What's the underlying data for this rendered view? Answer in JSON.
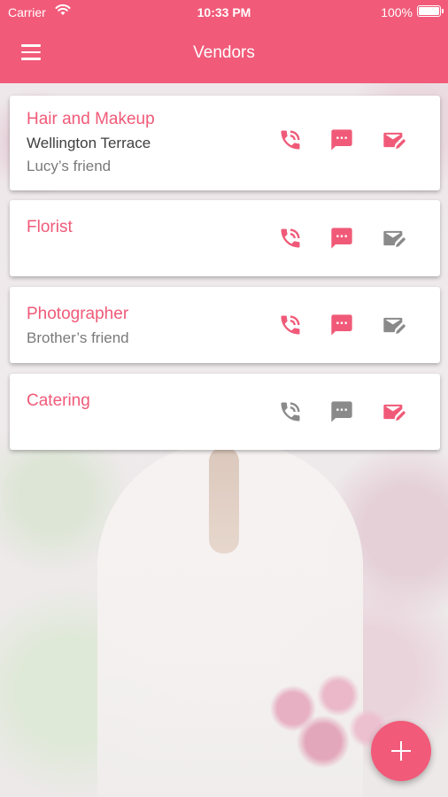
{
  "status_bar": {
    "carrier": "Carrier",
    "time": "10:33 PM",
    "battery": "100%"
  },
  "header": {
    "title": "Vendors"
  },
  "colors": {
    "accent": "#f25a79",
    "active_icon": "#f05a78",
    "inactive_icon": "#8a8a8a"
  },
  "vendors": [
    {
      "title": "Hair and Makeup",
      "line1": "Wellington Terrace",
      "line2": "Lucy’s friend",
      "phone_active": true,
      "message_active": true,
      "email_active": true
    },
    {
      "title": "Florist",
      "phone_active": true,
      "message_active": true,
      "email_active": false
    },
    {
      "title": "Photographer",
      "sub": "Brother’s friend",
      "phone_active": true,
      "message_active": true,
      "email_active": false
    },
    {
      "title": "Catering",
      "phone_active": false,
      "message_active": false,
      "email_active": true
    }
  ],
  "icons": {
    "phone": "phone-in-talk-icon",
    "message": "message-icon",
    "email": "email-edit-icon",
    "menu": "hamburger-menu-icon",
    "add": "plus-icon"
  }
}
